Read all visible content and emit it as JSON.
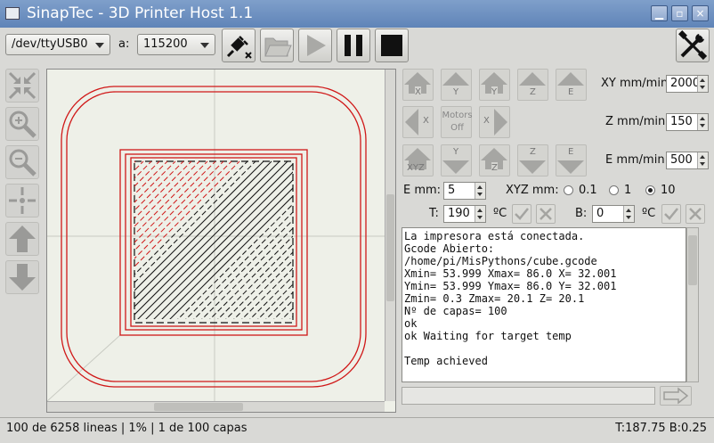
{
  "window": {
    "title": "SinapTec - 3D Printer Host 1.1",
    "buttons": [
      "minimize",
      "maximize",
      "close"
    ]
  },
  "toolbar": {
    "port": "/dev/ttyUSB0",
    "baud_label": "a:",
    "baud": "115200",
    "icons": [
      "plug-disconnect-icon",
      "folder-open-icon",
      "play-icon",
      "pause-icon",
      "stop-icon",
      "tools-icon"
    ]
  },
  "jog": {
    "motors_label_1": "Motors",
    "motors_label_2": "Off",
    "x": "X",
    "y": "Y",
    "z": "Z",
    "e": "E",
    "xyz": "XYZ",
    "xy_label": "XY mm/min:",
    "xy_value": "2000",
    "z_label": "Z mm/min:",
    "z_value": "150",
    "e_label": "E mm/min:",
    "e_value": "500",
    "emm_label": "E mm:",
    "emm_value": "5",
    "xyzmm_label": "XYZ mm:",
    "steps": [
      "0.1",
      "1",
      "10"
    ],
    "step_selected": "10"
  },
  "temps": {
    "t_label": "T:",
    "t_value": "190",
    "t_unit": "ºC",
    "b_label": "B:",
    "b_value": "0",
    "b_unit": "ºC"
  },
  "log": {
    "lines": [
      "La impresora está conectada.",
      "Gcode Abierto:",
      "/home/pi/MisPythons/cube.gcode",
      "Xmin= 53.999 Xmax= 86.0 X= 32.001",
      "Ymin= 53.999 Ymax= 86.0 Y= 32.001",
      "Zmin= 0.3 Zmax= 20.1 Z= 20.1",
      "Nº de capas= 100",
      "ok",
      "ok Waiting for target temp",
      "",
      "Temp achieved"
    ]
  },
  "status": {
    "left": "100 de 6258 lineas | 1% | 1 de 100 capas",
    "right": "T:187.75 B:0.25"
  },
  "colors": {
    "titlebar": "#6a8dc0",
    "path_red": "#d01818",
    "path_black": "#111111"
  }
}
